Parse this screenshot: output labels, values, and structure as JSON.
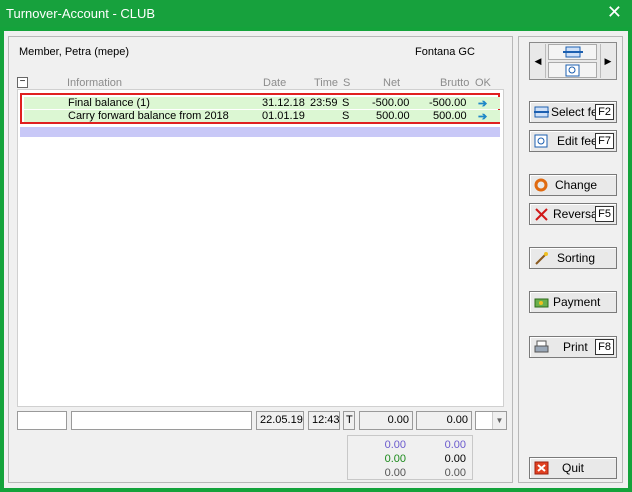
{
  "window": {
    "title": "Turnover-Account - CLUB",
    "close_glyph": "✕"
  },
  "header": {
    "member": "Member, Petra (mepe)",
    "club": "Fontana GC"
  },
  "columns": {
    "information": "Information",
    "date": "Date",
    "time": "Time",
    "s": "S",
    "net": "Net",
    "brutto": "Brutto",
    "ok": "OK"
  },
  "rows": [
    {
      "information": "Final balance (1)",
      "date": "31.12.18",
      "time": "23:59",
      "s": "S",
      "net": "-500.00",
      "brutto": "-500.00"
    },
    {
      "information": "Carry forward balance from 2018",
      "date": "01.01.19",
      "time": "",
      "s": "S",
      "net": "500.00",
      "brutto": "500.00"
    }
  ],
  "bottom_fields": {
    "field1": "",
    "field2": "",
    "date": "22.05.19",
    "time": "12:43",
    "type": "T",
    "net": "0.00",
    "brutto": "0.00",
    "dropdown": ""
  },
  "totals": [
    {
      "net": "0.00",
      "brutto": "0.00",
      "color": "#6a5acd"
    },
    {
      "net": "0.00",
      "brutto": "0.00",
      "color": "#1a8a1a"
    },
    {
      "net": "0.00",
      "brutto": "0.00",
      "color": "#555555"
    }
  ],
  "buttons": {
    "select_fee": {
      "label": "Select fee",
      "key": "F2",
      "icon": "select-fee-icon"
    },
    "edit_fee": {
      "label": "Edit fee",
      "key": "F7",
      "icon": "edit-icon"
    },
    "change": {
      "label": "Change",
      "icon": "ring-icon"
    },
    "reversal": {
      "label": "Reversal",
      "key": "F5",
      "icon": "x-icon"
    },
    "sorting": {
      "label": "Sorting",
      "icon": "wand-icon"
    },
    "payment": {
      "label": "Payment",
      "icon": "money-icon"
    },
    "print": {
      "label": "Print",
      "key": "F8",
      "icon": "printer-icon"
    },
    "quit": {
      "label": "Quit",
      "icon": "quit-icon"
    }
  },
  "colors": {
    "title_bar": "#17a13d",
    "row_highlight": "#dcf7d3",
    "selection_frame": "#e02020",
    "purple_row": "#c8c8f7",
    "ok_arrow": "#1e88c8"
  }
}
